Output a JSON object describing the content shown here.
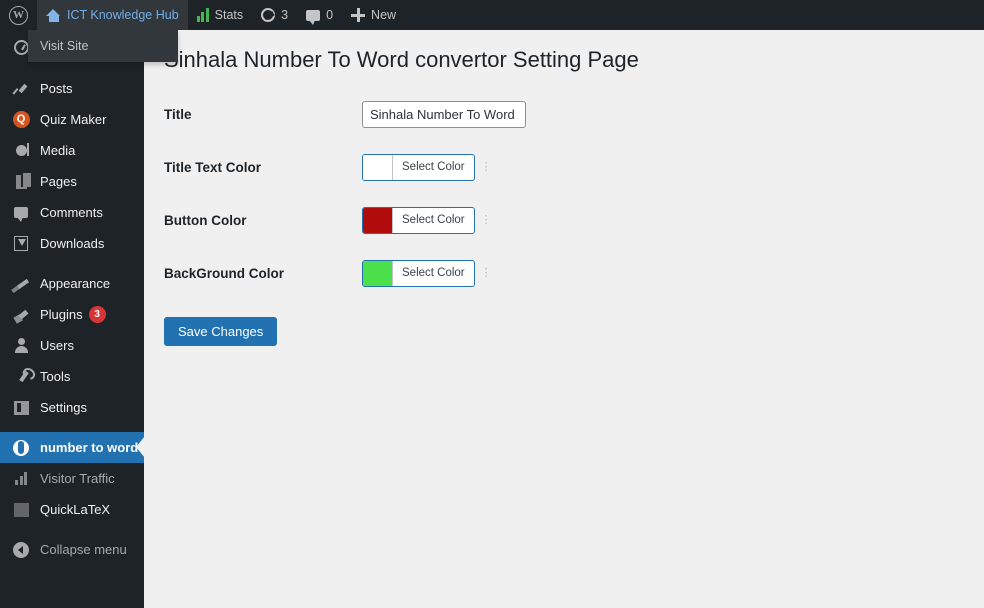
{
  "adminbar": {
    "wp_logo_name": "wordpress-logo",
    "site_name": "ICT Knowledge Hub",
    "visit_site_label": "Visit Site",
    "stats_label": "Stats",
    "updates_count": "3",
    "comments_count": "0",
    "new_label": "New"
  },
  "sidebar": {
    "items": [
      {
        "label": "",
        "icon": "dashboard-icon",
        "id": "dashboard"
      },
      {
        "label": "Posts",
        "icon": "pin-icon",
        "id": "posts"
      },
      {
        "label": "Quiz Maker",
        "icon": "quiz-maker-icon",
        "id": "quiz-maker"
      },
      {
        "label": "Media",
        "icon": "media-icon",
        "id": "media"
      },
      {
        "label": "Pages",
        "icon": "pages-icon",
        "id": "pages"
      },
      {
        "label": "Comments",
        "icon": "comments-icon",
        "id": "comments"
      },
      {
        "label": "Downloads",
        "icon": "downloads-icon",
        "id": "downloads"
      },
      {
        "label": "Appearance",
        "icon": "brush-icon",
        "id": "appearance"
      },
      {
        "label": "Plugins",
        "icon": "plugin-icon",
        "id": "plugins",
        "badge": "3"
      },
      {
        "label": "Users",
        "icon": "user-icon",
        "id": "users"
      },
      {
        "label": "Tools",
        "icon": "wrench-icon",
        "id": "tools"
      },
      {
        "label": "Settings",
        "icon": "settings-icon",
        "id": "settings"
      },
      {
        "label": "number to word",
        "icon": "number-to-word-icon",
        "id": "number-to-word",
        "active": true
      },
      {
        "label": "Visitor Traffic",
        "icon": "traffic-chart-icon",
        "id": "visitor-traffic"
      },
      {
        "label": "QuickLaTeX",
        "icon": "quicklatex-icon",
        "id": "quicklatex"
      },
      {
        "label": "Collapse menu",
        "icon": "collapse-icon",
        "id": "collapse-menu"
      }
    ]
  },
  "main": {
    "page_title": "Sinhala Number To Word convertor Setting Page",
    "fields": [
      {
        "label": "Title",
        "type": "text",
        "value": "Sinhala Number To Word C"
      },
      {
        "label": "Title Text Color",
        "type": "color",
        "button_label": "Select Color",
        "color": "#ffffff",
        "dots": "⋮"
      },
      {
        "label": "Button Color",
        "type": "color",
        "button_label": "Select Color",
        "color": "#b00c0c",
        "dots": "⋮"
      },
      {
        "label": "BackGround Color",
        "type": "color",
        "button_label": "Select Color",
        "color": "#4ce04c",
        "dots": "⋮"
      }
    ],
    "save_label": "Save Changes"
  },
  "colors": {
    "admin_dark": "#1d2327",
    "admin_panel": "#32373c",
    "accent_blue": "#2271b1",
    "content_bg": "#f0f0f1",
    "badge_red": "#d63638"
  }
}
